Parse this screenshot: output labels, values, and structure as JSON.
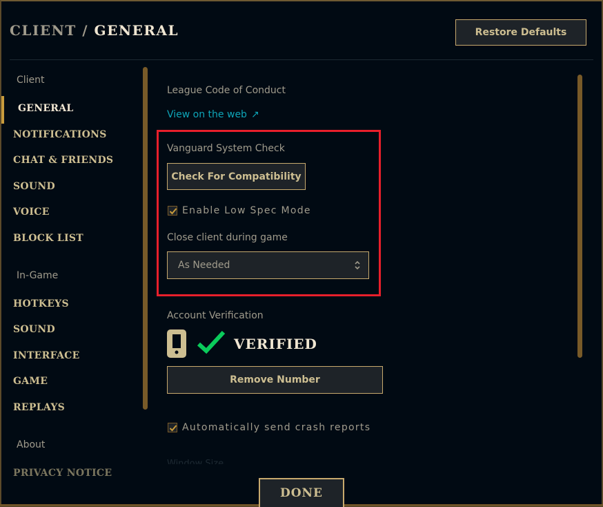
{
  "header": {
    "section": "CLIENT",
    "separator": "/",
    "current": "GENERAL",
    "restore_label": "Restore Defaults"
  },
  "sidebar": {
    "client_category": "Client",
    "client_items": [
      "GENERAL",
      "NOTIFICATIONS",
      "CHAT & FRIENDS",
      "SOUND",
      "VOICE",
      "BLOCK LIST"
    ],
    "ingame_category": "In-Game",
    "ingame_items": [
      "HOTKEYS",
      "SOUND",
      "INTERFACE",
      "GAME",
      "REPLAYS"
    ],
    "about_category": "About",
    "about_items": [
      "PRIVACY NOTICE"
    ],
    "active": "GENERAL"
  },
  "main": {
    "code_of_conduct_label": "League Code of Conduct",
    "view_web_link": "View on the web",
    "vanguard_label": "Vanguard System Check",
    "check_compat_label": "Check For Compatibility",
    "low_spec_label": "Enable Low Spec Mode",
    "low_spec_checked": true,
    "close_client_label": "Close client during game",
    "close_client_value": "As Needed",
    "account_verification_label": "Account Verification",
    "verified_text": "VERIFIED",
    "remove_number_label": "Remove Number",
    "crash_reports_label": "Automatically send crash reports",
    "crash_reports_checked": true,
    "window_size_label": "Window Size"
  },
  "footer": {
    "done_label": "DONE"
  },
  "colors": {
    "gold": "#c8aa6e",
    "highlight": "#e81f2b",
    "verified_check": "#0acb5b",
    "link": "#0ea5b8"
  }
}
